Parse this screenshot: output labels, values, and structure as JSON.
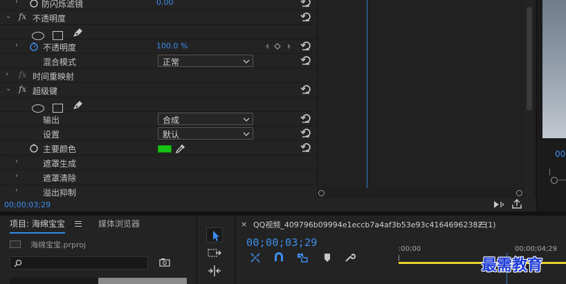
{
  "effect_controls": {
    "rows": [
      {
        "label": "防闪烁滤镜",
        "value": "0.00"
      },
      {
        "label": "不透明度"
      },
      {
        "label": "不透明度",
        "value": "100.0 %"
      },
      {
        "label": "混合模式",
        "select": "正常"
      },
      {
        "label": "时间重映射"
      },
      {
        "label": "超级键"
      },
      {
        "label": "输出",
        "select": "合成"
      },
      {
        "label": "设置",
        "select": "默认"
      },
      {
        "label": "主要颜色",
        "swatch": "#17c417"
      },
      {
        "label": "遮罩生成"
      },
      {
        "label": "遮罩清除"
      },
      {
        "label": "溢出抑制"
      }
    ],
    "fx_label": "fx",
    "timecode": "00;00;03;29"
  },
  "monitor": {
    "timecode": "00"
  },
  "project": {
    "tab_project": "项目: 海绵宝宝",
    "tab_media": "媒体浏览器",
    "file": "海绵宝宝.prproj",
    "search_placeholder": ""
  },
  "timeline": {
    "close": "×",
    "title": "QQ视频_409796b09994e1eccb7a4af3b53e93c41646962382 (1)",
    "timecode": "00;00;03;29",
    "ruler_start": ":00;00",
    "ruler_end": "00;00;04;29"
  },
  "watermark": "最需教育",
  "colors": {
    "accent": "#3e8ef0",
    "key_color": "#17c417",
    "work_area": "#e8d42a"
  },
  "icons": {
    "reset": "reset-icon",
    "stopwatch": "stopwatch-icon",
    "ellipse": "ellipse-mask-icon",
    "rectangle": "rectangle-mask-icon",
    "pen": "pen-mask-icon",
    "eyedropper": "eyedropper-icon",
    "selection": "selection-tool-icon",
    "track-select": "track-select-tool-icon",
    "ripple": "ripple-edit-tool-icon"
  }
}
